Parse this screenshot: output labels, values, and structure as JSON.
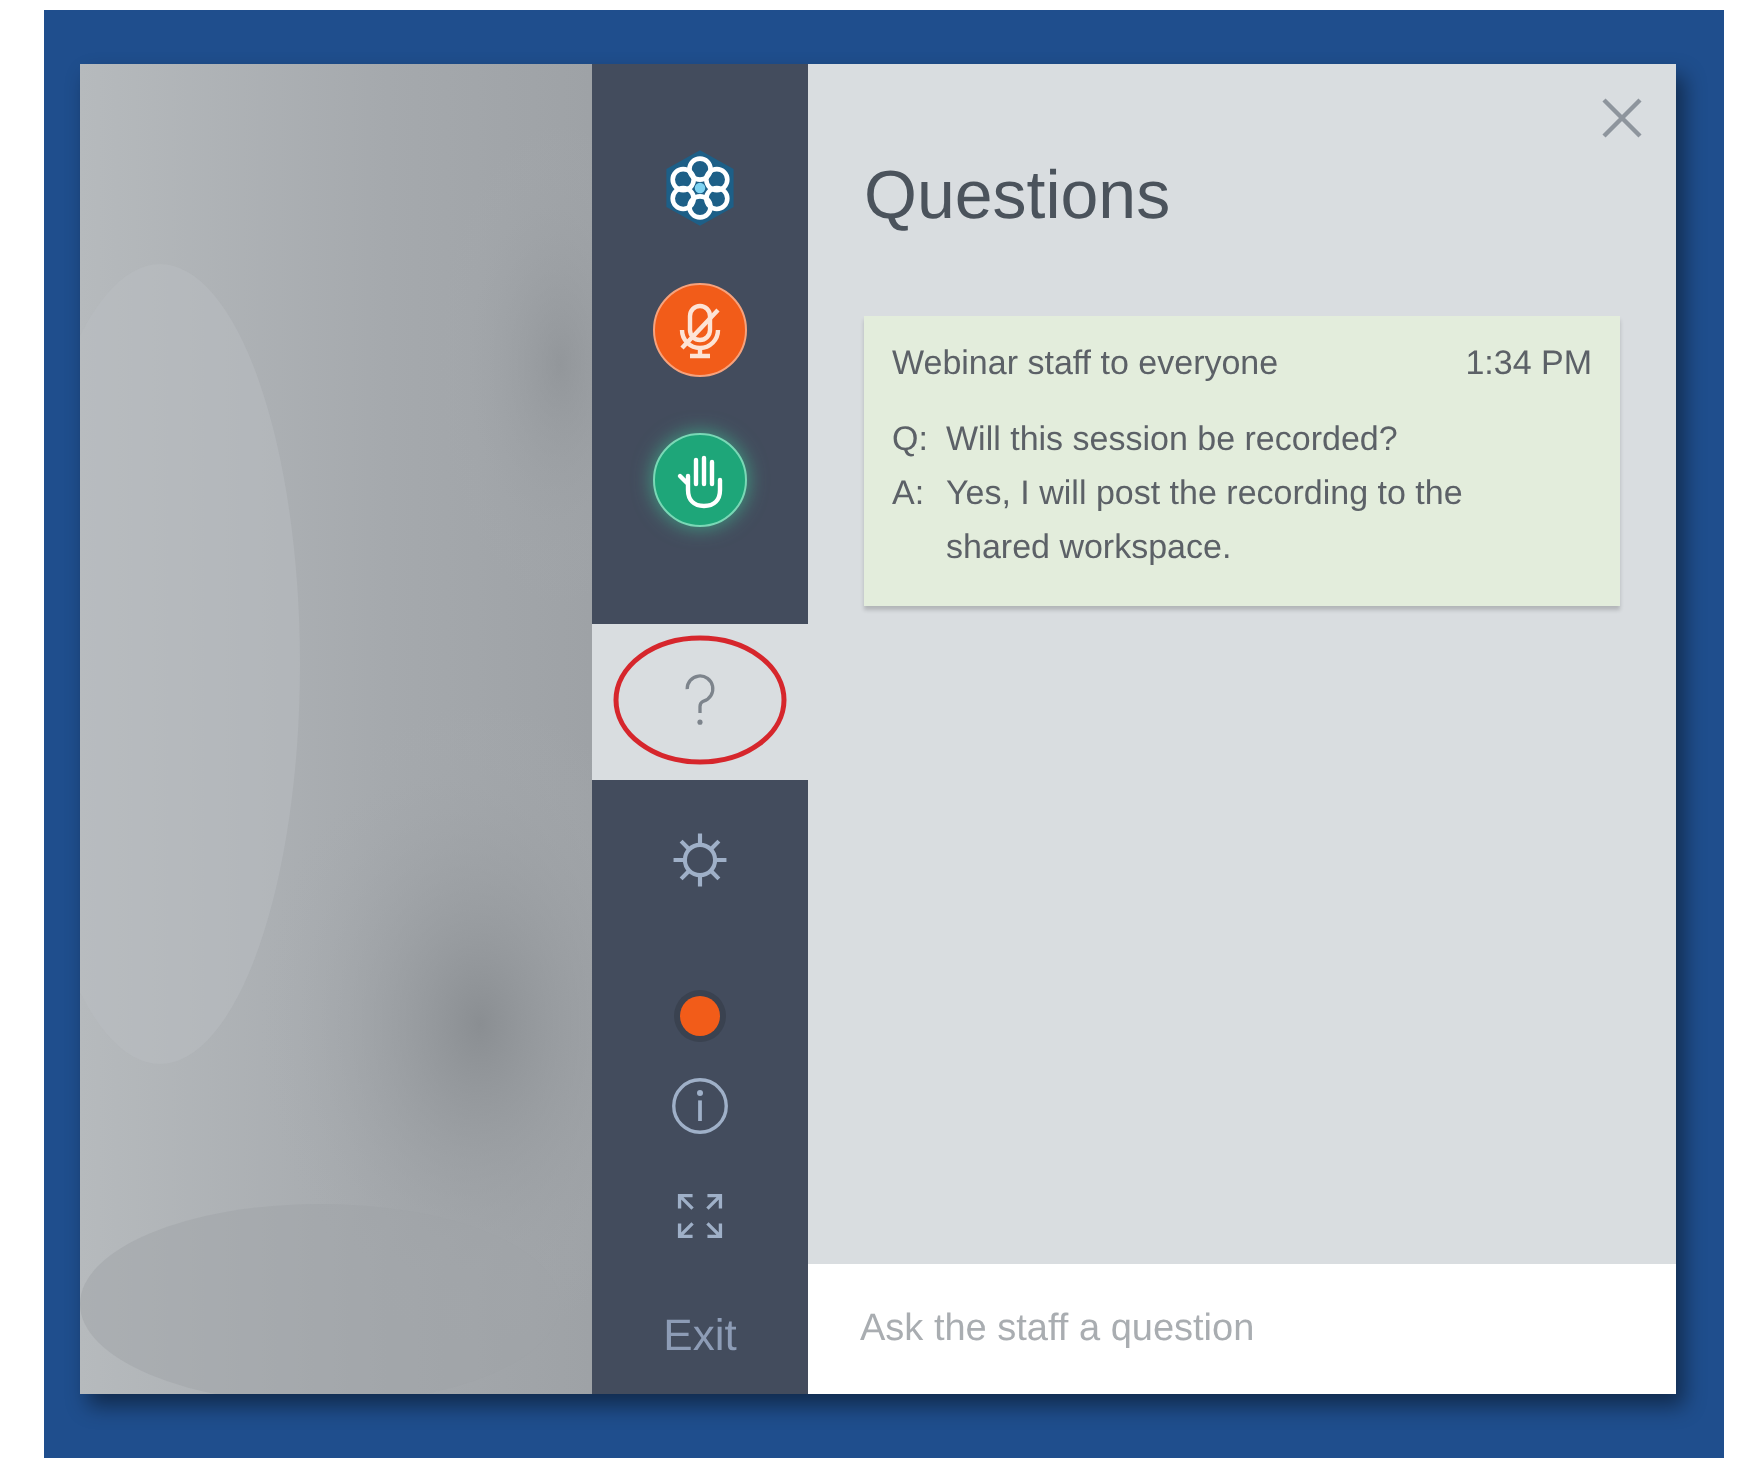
{
  "sidebar": {
    "items": [
      {
        "kind": "logo",
        "selected": false
      },
      {
        "kind": "microphone",
        "selected": false
      },
      {
        "kind": "hand",
        "selected": false
      },
      {
        "kind": "question",
        "selected": true,
        "circled": true
      },
      {
        "kind": "gear",
        "selected": false
      },
      {
        "kind": "dot",
        "selected": false,
        "color": "#f25c19"
      },
      {
        "kind": "info",
        "selected": false
      },
      {
        "kind": "expand",
        "selected": false
      },
      {
        "kind": "exit",
        "selected": false,
        "label": "Exit"
      }
    ]
  },
  "panel": {
    "title": "Questions",
    "messages": [
      {
        "sender": "Webinar staff to everyone",
        "time": "1:34 PM",
        "lines": [
          {
            "prefix": "Q:",
            "text": "Will this session be recorded?"
          },
          {
            "prefix": "A:",
            "text": "Yes, I will post the recording to the shared workspace."
          }
        ]
      }
    ],
    "input": {
      "placeholder": "Ask the staff a question"
    }
  }
}
